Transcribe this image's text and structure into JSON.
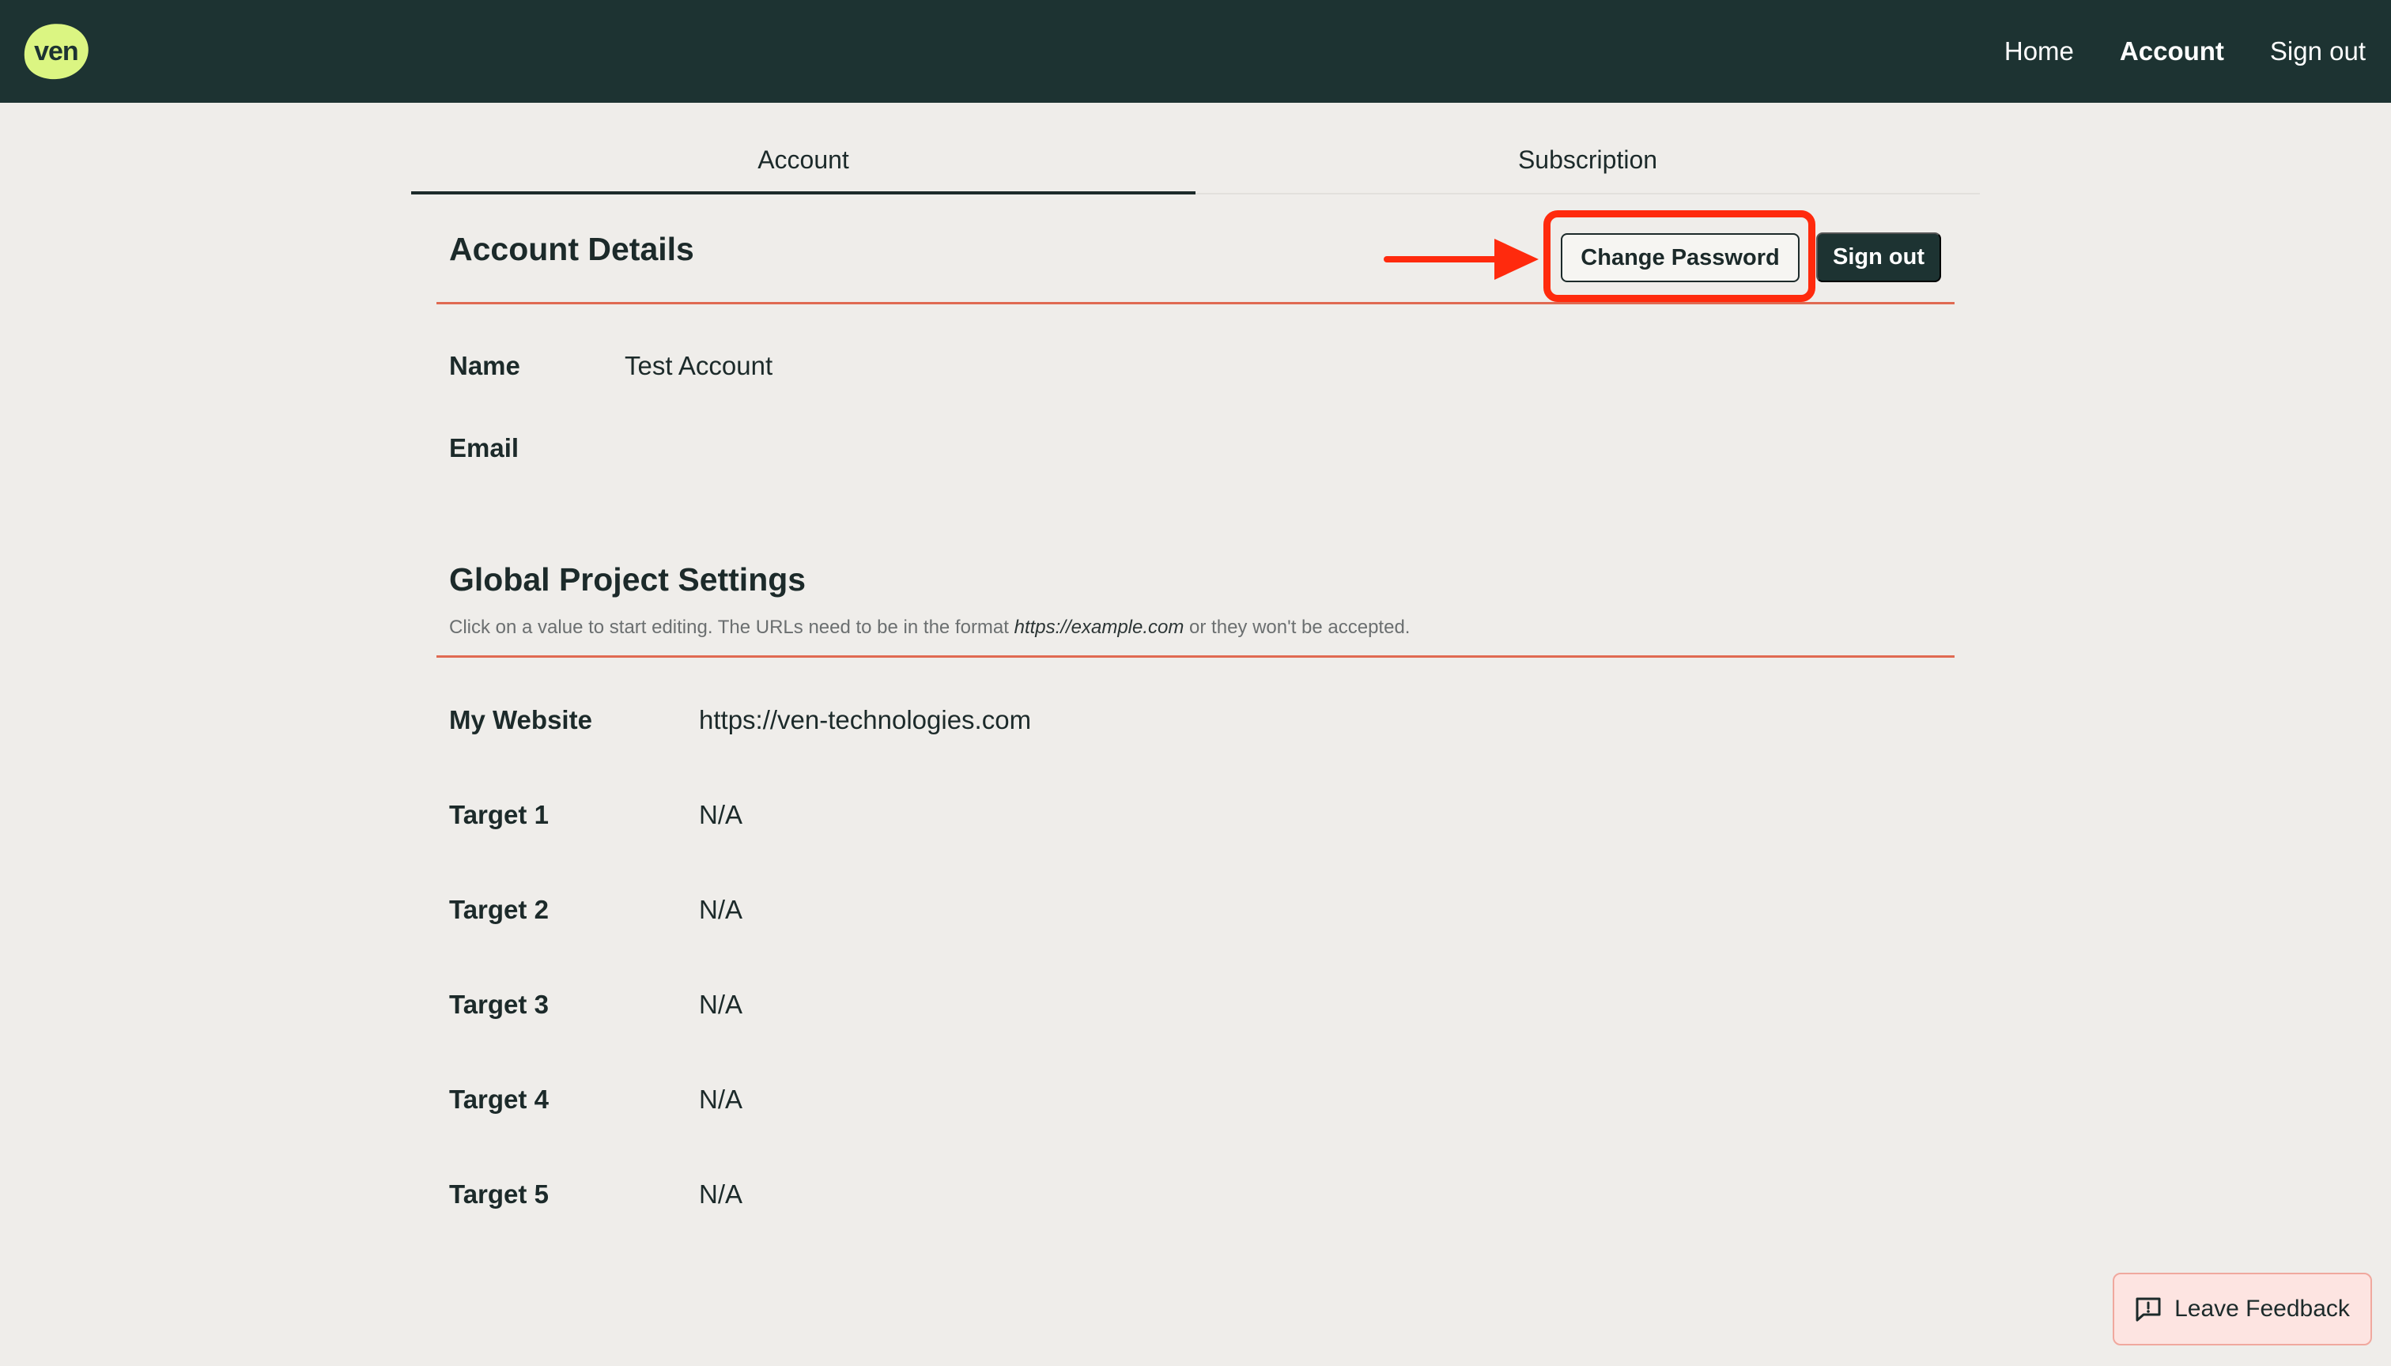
{
  "brand": {
    "logo_text": "ven",
    "logo_color": "#dbf582",
    "bar_color": "#1d3332"
  },
  "nav": {
    "home": "Home",
    "account": "Account",
    "sign_out": "Sign out"
  },
  "tabs": [
    {
      "label": "Account",
      "active": true
    },
    {
      "label": "Subscription",
      "active": false
    }
  ],
  "account_details": {
    "title": "Account Details",
    "change_password": "Change Password",
    "sign_out": "Sign out",
    "rows": [
      {
        "label": "Name",
        "value": "Test Account"
      },
      {
        "label": "Email",
        "value": ""
      }
    ]
  },
  "global_settings": {
    "title": "Global Project Settings",
    "hint_before": "Click on a value to start editing. The URLs need to be in the format ",
    "hint_example": "https://example.com",
    "hint_after": " or they won't be accepted.",
    "rows": [
      {
        "label": "My Website",
        "value": "https://ven-technologies.com"
      },
      {
        "label": "Target 1",
        "value": "N/A"
      },
      {
        "label": "Target 2",
        "value": "N/A"
      },
      {
        "label": "Target 3",
        "value": "N/A"
      },
      {
        "label": "Target 4",
        "value": "N/A"
      },
      {
        "label": "Target 5",
        "value": "N/A"
      }
    ]
  },
  "feedback": {
    "label": "Leave Feedback",
    "icon": "feedback-icon"
  },
  "annotation": {
    "color": "#ff2a0d"
  },
  "accent": "#e06a52"
}
